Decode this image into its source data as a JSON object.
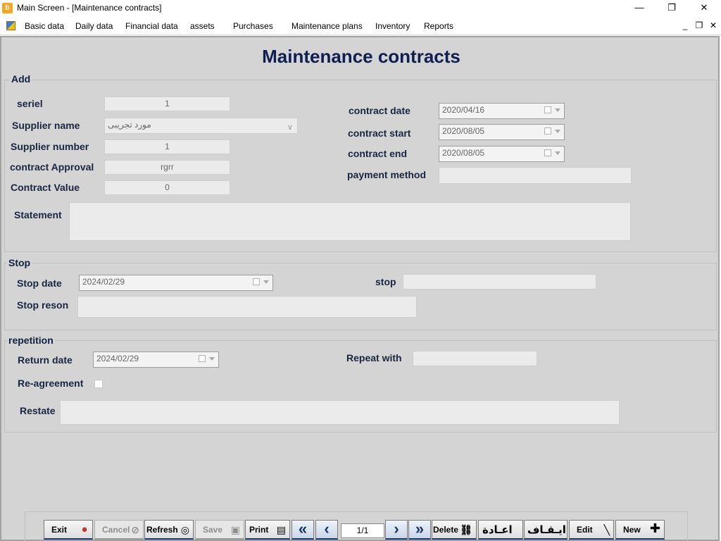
{
  "window": {
    "title": "Main Screen - [Maintenance contracts]",
    "minimize_icon": "minimize-icon",
    "maximize_icon": "restore-icon",
    "close_icon": "close-icon"
  },
  "menu": {
    "items": [
      "Basic data",
      "Daily data",
      "Financial data",
      "assets",
      "Purchases",
      "Maintenance plans",
      "Inventory",
      "Reports"
    ]
  },
  "page": {
    "title": "Maintenance contracts"
  },
  "add": {
    "group_label": "Add",
    "seriel_label": "seriel",
    "seriel_value": "1",
    "supplier_name_label": "Supplier name",
    "supplier_name_value": "مورد تجريبى",
    "supplier_number_label": "Supplier number",
    "supplier_number_value": "1",
    "contract_approval_label": "contract Approval",
    "contract_approval_value": "rgrr",
    "contract_value_label": "Contract Value",
    "contract_value_value": "0",
    "contract_date_label": "contract date",
    "contract_date_value": "2020/04/16",
    "contract_start_label": "contract start",
    "contract_start_value": "2020/08/05",
    "contract_end_label": "contract end",
    "contract_end_value": "2020/08/05",
    "payment_method_label": "payment method",
    "payment_method_value": "",
    "statement_label": "Statement",
    "statement_value": ""
  },
  "stop": {
    "group_label": "Stop",
    "stop_date_label": "Stop date",
    "stop_date_value": "2024/02/29",
    "stop_label": "stop",
    "stop_value": "",
    "stop_reson_label": "Stop reson",
    "stop_reson_value": ""
  },
  "repetition": {
    "group_label": "repetition",
    "return_date_label": "Return date",
    "return_date_value": "2024/02/29",
    "repeat_with_label": "Repeat with",
    "repeat_with_value": "",
    "reagreement_label": "Re-agreement",
    "reagreement_checked": false,
    "restate_label": "Restate",
    "restate_value": ""
  },
  "toolbar": {
    "exit": "Exit",
    "cancel": "Cancel",
    "refresh": "Refresh",
    "save": "Save",
    "print": "Print",
    "pager": "1/1",
    "delete": "Delete",
    "restore": "اعـادة",
    "stop": "ايـقـاف",
    "edit": "Edit",
    "new": "New"
  },
  "colors": {
    "title_color": "#0f1f52",
    "background": "#d4d4d4",
    "button_border_accent": "#1d3b73"
  }
}
